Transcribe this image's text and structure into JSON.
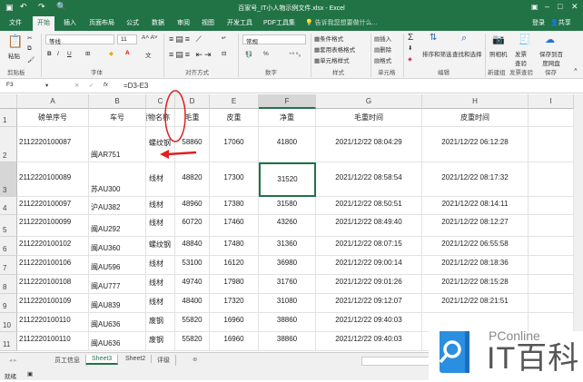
{
  "window": {
    "title": "百家号_IT小人物示例文件.xlsx - Excel"
  },
  "ribbon_tabs": [
    {
      "label": "文件"
    },
    {
      "label": "开始"
    },
    {
      "label": "插入"
    },
    {
      "label": "页面布局"
    },
    {
      "label": "公式"
    },
    {
      "label": "数据"
    },
    {
      "label": "审阅"
    },
    {
      "label": "视图"
    },
    {
      "label": "开发工具"
    },
    {
      "label": "PDF工具集"
    }
  ],
  "tell_me": "告诉我您想要做什么...",
  "account": {
    "login": "登录",
    "share": "共享"
  },
  "ribbon": {
    "paste": "粘贴",
    "clipboard": "剪贴板",
    "font_name": "等线",
    "font_size": "11",
    "font_group": "字体",
    "bold": "B",
    "italic": "I",
    "underline": "U",
    "align_group": "对齐方式",
    "number_format": "常规",
    "number_group": "数字",
    "percent": "%",
    "cond_format": "条件格式",
    "table_format": "套用表格格式",
    "cell_style": "单元格样式",
    "style_group": "样式",
    "insert": "插入",
    "delete": "删除",
    "format": "格式",
    "cells_group": "单元格",
    "sort": "排序和筛选",
    "find": "查找和选择",
    "edit_group": "编辑",
    "camera": "照相机",
    "new_group": "新建组",
    "invoice": "发票查验",
    "invoice_group": "发票查验",
    "save_cloud": "保存到百度网盘",
    "save_group": "保存"
  },
  "formula_bar": {
    "name_box": "F3",
    "formula": "=D3-E3",
    "fx": "fx"
  },
  "columns": [
    "A",
    "B",
    "C",
    "D",
    "E",
    "F",
    "G",
    "H",
    "I"
  ],
  "rows": [
    {
      "n": "1",
      "cells": [
        "磅单序号",
        "车号",
        "货物名称",
        "毛重",
        "皮重",
        "净重",
        "毛重时间",
        "皮重时间"
      ]
    },
    {
      "n": "2",
      "cells": [
        "2112220100087",
        "闽AR751",
        "螺纹钢",
        "58860",
        "17060",
        "41800",
        "2021/12/22 08:04:29",
        "2021/12/22 06:12:28"
      ]
    },
    {
      "n": "3",
      "cells": [
        "2112220100089",
        "苏AU300",
        "线材",
        "48820",
        "17300",
        "31520",
        "2021/12/22 08:58:54",
        "2021/12/22 08:17:32"
      ]
    },
    {
      "n": "4",
      "cells": [
        "2112220100097",
        "沪AU382",
        "线材",
        "48960",
        "17380",
        "31580",
        "2021/12/22 08:50:51",
        "2021/12/22 08:14:11"
      ]
    },
    {
      "n": "5",
      "cells": [
        "2112220100099",
        "闽AU292",
        "线材",
        "60720",
        "17460",
        "43260",
        "2021/12/22 08:49:40",
        "2021/12/22 08:12:27"
      ]
    },
    {
      "n": "6",
      "cells": [
        "2112220100102",
        "闽AU360",
        "螺纹钢",
        "48840",
        "17480",
        "31360",
        "2021/12/22 08:07:15",
        "2021/12/22 06:55:58"
      ]
    },
    {
      "n": "7",
      "cells": [
        "2112220100106",
        "闽AU596",
        "线材",
        "53100",
        "16120",
        "36980",
        "2021/12/22 09:00:14",
        "2021/12/22 08:18:36"
      ]
    },
    {
      "n": "8",
      "cells": [
        "2112220100108",
        "闽AU777",
        "线材",
        "49740",
        "17980",
        "31760",
        "2021/12/22 09:01:26",
        "2021/12/22 08:15:28"
      ]
    },
    {
      "n": "9",
      "cells": [
        "2112220100109",
        "闽AU839",
        "线材",
        "48400",
        "17320",
        "31080",
        "2021/12/22 09:12:07",
        "2021/12/22 08:21:51"
      ]
    },
    {
      "n": "10",
      "cells": [
        "2112220100110",
        "闽AU636",
        "废钢",
        "55820",
        "16960",
        "38860",
        "2021/12/22 09:40:03",
        ""
      ]
    },
    {
      "n": "11",
      "cells": [
        "2112220100110",
        "闽AU636",
        "废钢",
        "55820",
        "16960",
        "38860",
        "2021/12/22 09:40:03",
        ""
      ]
    }
  ],
  "sheet_tabs": [
    {
      "label": "员工信息"
    },
    {
      "label": "Sheet3"
    },
    {
      "label": "Sheet2"
    },
    {
      "label": "评级"
    }
  ],
  "status": {
    "ready": "就绪"
  },
  "watermark": {
    "brand": "PConline",
    "name": "IT百科"
  },
  "colors": {
    "excel_green": "#217346",
    "annotation_red": "#e02020",
    "logo_blue": "#2a8fe0"
  }
}
